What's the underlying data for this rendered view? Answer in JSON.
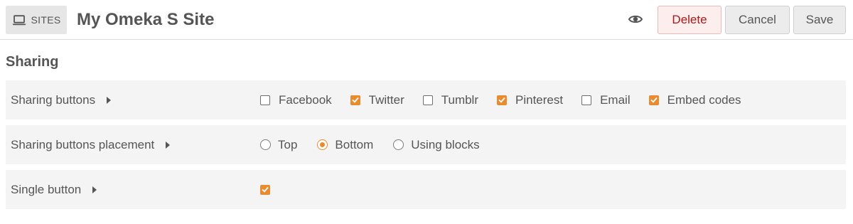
{
  "header": {
    "sites_label": "SITES",
    "site_title": "My Omeka S Site",
    "delete_label": "Delete",
    "cancel_label": "Cancel",
    "save_label": "Save"
  },
  "section": {
    "title": "Sharing"
  },
  "rows": [
    {
      "label": "Sharing buttons",
      "type": "checkbox",
      "options": [
        {
          "label": "Facebook",
          "checked": false
        },
        {
          "label": "Twitter",
          "checked": true
        },
        {
          "label": "Tumblr",
          "checked": false
        },
        {
          "label": "Pinterest",
          "checked": true
        },
        {
          "label": "Email",
          "checked": false
        },
        {
          "label": "Embed codes",
          "checked": true
        }
      ]
    },
    {
      "label": "Sharing buttons placement",
      "type": "radio",
      "options": [
        {
          "label": "Top",
          "checked": false
        },
        {
          "label": "Bottom",
          "checked": true
        },
        {
          "label": "Using blocks",
          "checked": false
        }
      ]
    },
    {
      "label": "Single button",
      "type": "checkbox",
      "options": [
        {
          "label": "",
          "checked": true
        }
      ]
    }
  ],
  "icons": {
    "sites": "laptop-icon",
    "view": "eye-icon",
    "expand": "caret-right-icon"
  },
  "colors": {
    "accent": "#e98b2f",
    "delete_text": "#a91919",
    "delete_bg": "#fdeeee"
  }
}
